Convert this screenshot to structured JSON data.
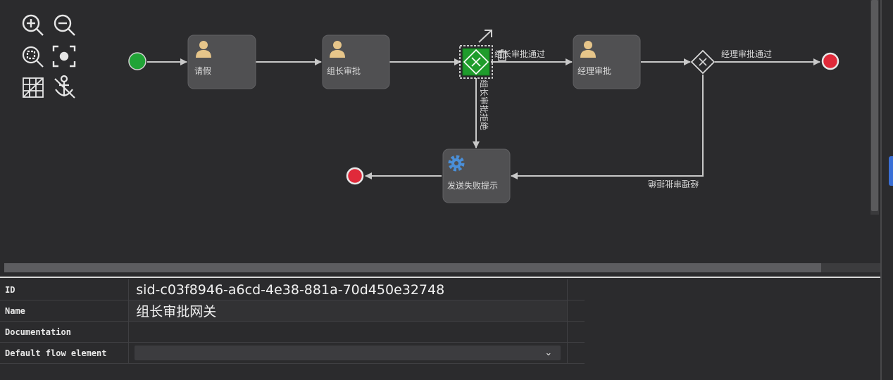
{
  "toolbar": {
    "icons": [
      "zoom-in-icon",
      "zoom-out-icon",
      "zoom-actual-icon",
      "zoom-fit-icon",
      "grid-icon",
      "anchor-icon"
    ]
  },
  "diagram": {
    "tasks": {
      "leave_request": "请假",
      "team_lead_approval": "组长审批",
      "manager_approval": "经理审批",
      "send_failure": "发送失败提示"
    },
    "flows": {
      "team_lead_pass": "组长审批通过",
      "team_lead_reject": "组长审批拒绝",
      "manager_pass": "经理审批通过",
      "manager_reject": "经理审批拒绝"
    },
    "colors": {
      "start": "#20a336",
      "end": "#e02a3a",
      "selected_gateway": "#1f9c2c",
      "task_fill": "#505052",
      "user_icon": "#e6c58a",
      "service_icon": "#4a8fd8"
    }
  },
  "properties": {
    "rows": [
      {
        "label": "ID",
        "value": "sid-c03f8946-a6cd-4e38-881a-70d450e32748"
      },
      {
        "label": "Name",
        "value": "组长审批网关"
      },
      {
        "label": "Documentation",
        "value": ""
      },
      {
        "label": "Default flow element",
        "value": ""
      }
    ]
  }
}
